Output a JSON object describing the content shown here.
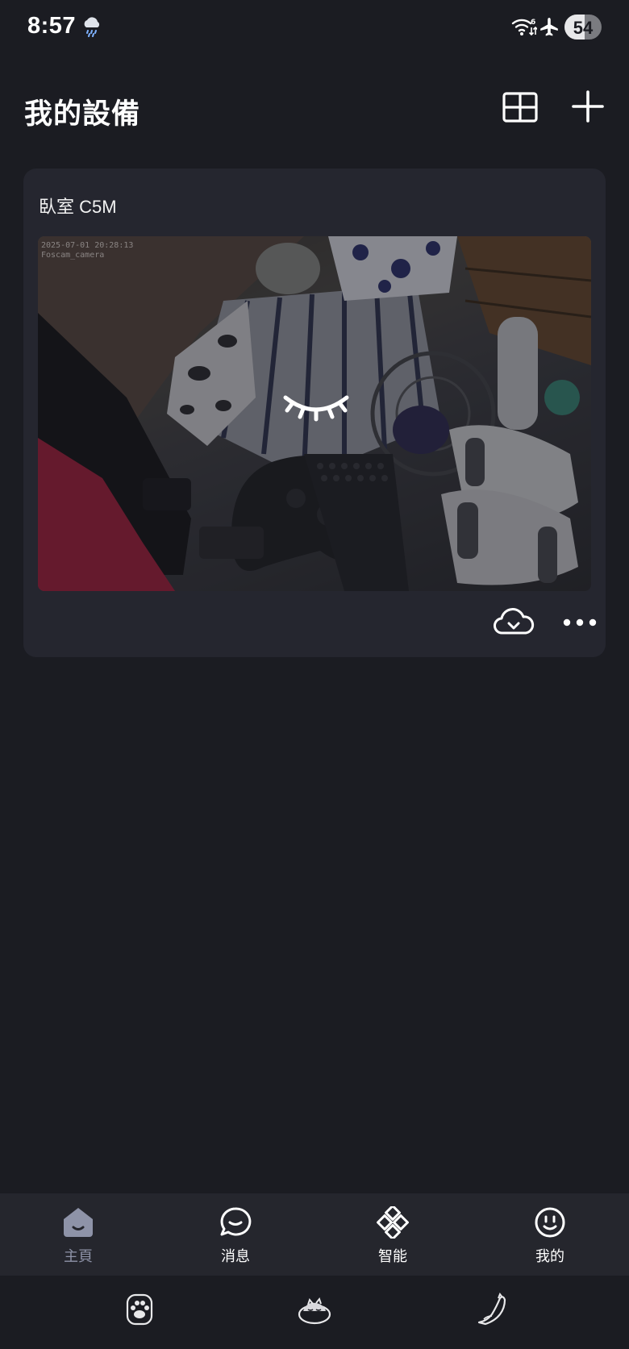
{
  "status_bar": {
    "time": "8:57",
    "battery_percent": "54",
    "battery_level": 0.54,
    "icons": [
      "rain-cloud-icon",
      "wifi-icon",
      "airplane-icon"
    ]
  },
  "header": {
    "title": "我的設備"
  },
  "device": {
    "name": "臥室 C5M",
    "timestamp": "2025-07-01 20:28:13",
    "camera_label": "Foscam_camera",
    "status_icon": "closed-eye-icon"
  },
  "tabs": [
    {
      "label": "主頁",
      "icon": "home-icon",
      "active": true
    },
    {
      "label": "消息",
      "icon": "message-bubble-icon",
      "active": false
    },
    {
      "label": "智能",
      "icon": "diamond-grid-icon",
      "active": false
    },
    {
      "label": "我的",
      "icon": "smiley-icon",
      "active": false
    }
  ],
  "colors": {
    "background": "#1b1c22",
    "card": "#25262f",
    "tab_bar": "#25262d",
    "active_tab": "#8e93a8"
  }
}
